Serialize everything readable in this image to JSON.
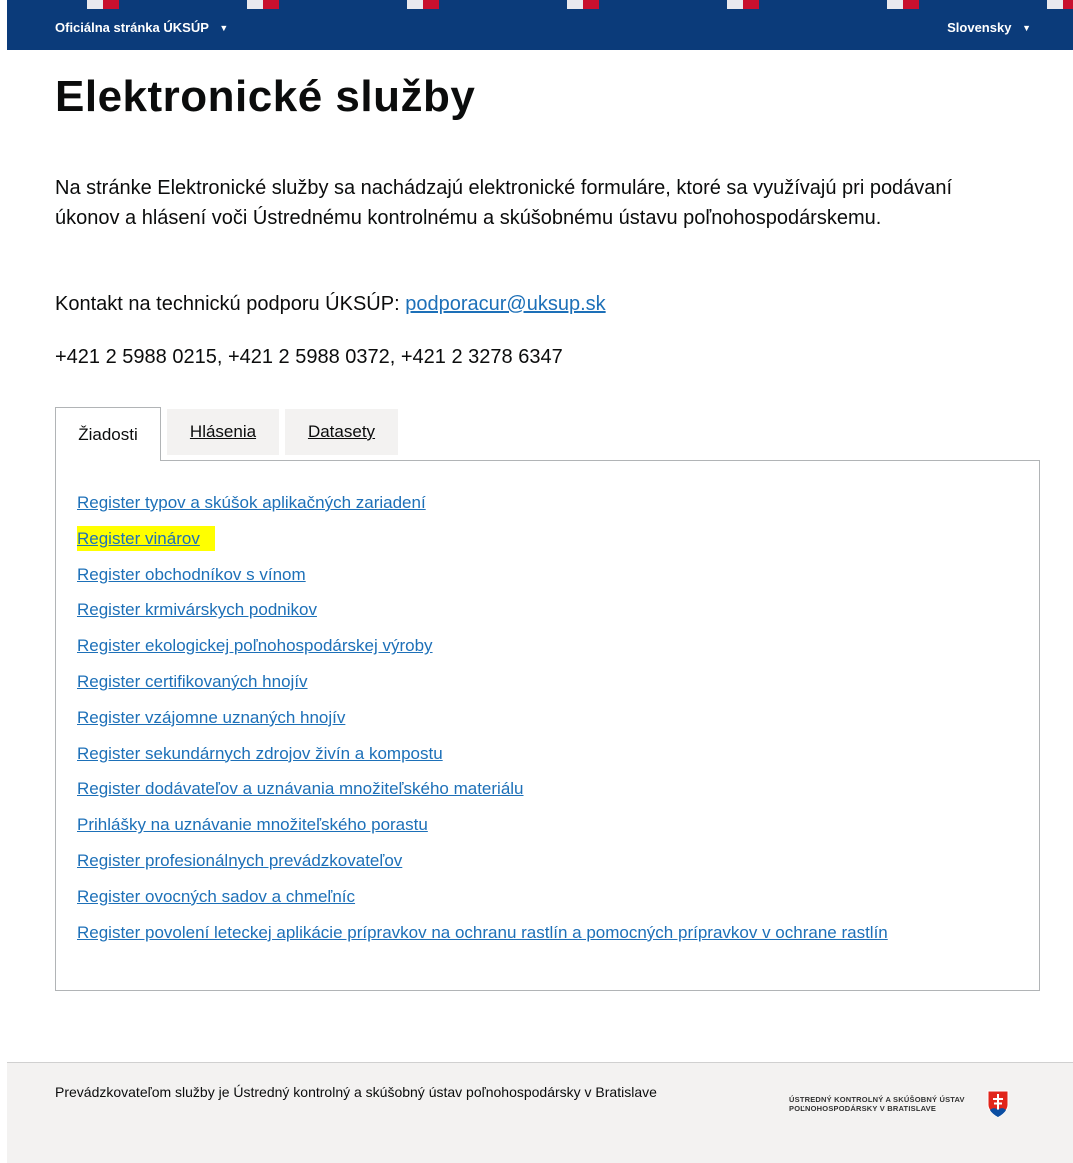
{
  "topbar": {
    "official_prefix": "Oficiálna stránka",
    "official_org": "ÚKSÚP",
    "language": "Slovensky"
  },
  "page_title": "Elektronické služby",
  "intro": "Na stránke Elektronické služby sa nachádzajú elektronické formuláre, ktoré sa využívajú pri podávaní úkonov a hlásení voči Ústrednému kontrolnému a skúšobnému ústavu poľnohospodárskemu.",
  "contact": {
    "label": "Kontakt na technickú podporu ÚKSÚP:",
    "email": "podporacur@uksup.sk",
    "phones": "+421 2 5988 0215, +421 2 5988 0372, +421 2 3278 6347"
  },
  "tabs": [
    "Žiadosti",
    "Hlásenia",
    "Datasety"
  ],
  "links": [
    "Register typov a skúšok aplikačných zariadení",
    "Register vinárov",
    "Register obchodníkov s vínom",
    "Register krmivárskych podnikov",
    "Register ekologickej poľnohospodárskej výroby",
    "Register certifikovaných hnojív",
    "Register vzájomne uznaných hnojív",
    "Register sekundárnych zdrojov živín a kompostu",
    "Register dodávateľov a uznávania množiteľského materiálu",
    "Prihlášky na uznávanie množiteľského porastu",
    "Register profesionálnych prevádzkovateľov",
    "Register ovocných sadov a chmeľníc",
    "Register povolení leteckej aplikácie prípravkov na ochranu rastlín a pomocných prípravkov v ochrane rastlín"
  ],
  "highlight_color": "#ffff00",
  "footer": {
    "operator": "Prevádzkovateľom služby je Ústredný kontrolný a skúšobný ústav poľnohospodársky v Bratislave",
    "logo_line1": "ÚSTREDNÝ KONTROLNÝ A SKÚŠOBNÝ ÚSTAV",
    "logo_line2": "POĽNOHOSPODÁRSKY V BRATISLAVE"
  },
  "colors": {
    "header": "#0b3b7a",
    "link": "#1d70b8",
    "footer_bg": "#f3f2f1"
  }
}
